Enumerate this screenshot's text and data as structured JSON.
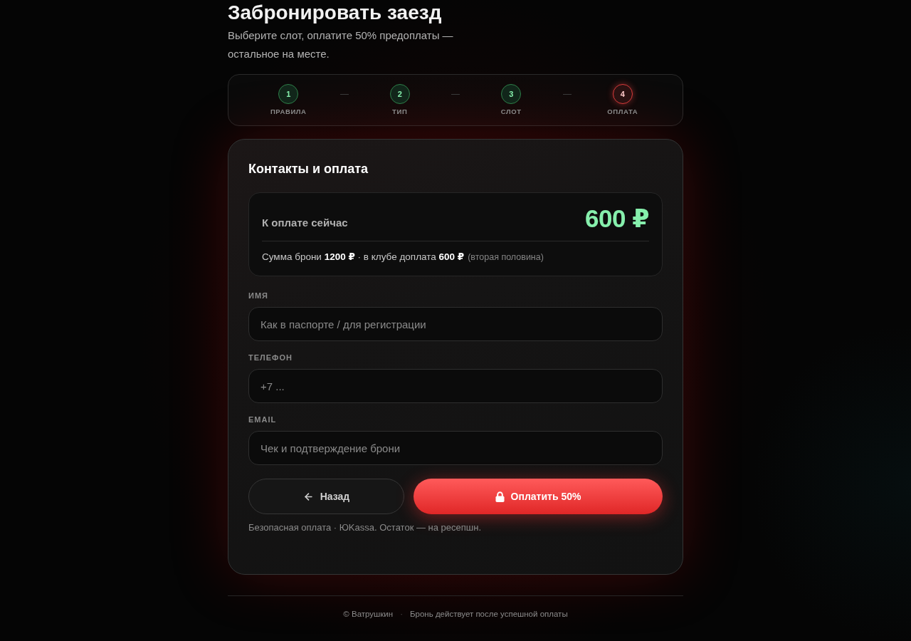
{
  "header": {
    "title": "Забронировать заезд",
    "subtitle": "Выберите слот, оплатите 50% предоплаты — остальное на месте."
  },
  "steps": [
    {
      "number": "1",
      "label": "ПРАВИЛА",
      "done": true,
      "selected": false
    },
    {
      "number": "2",
      "label": "ТИП",
      "done": true,
      "selected": false
    },
    {
      "number": "3",
      "label": "СЛОТ",
      "done": true,
      "selected": false
    },
    {
      "number": "4",
      "label": "ОПЛАТА",
      "done": false,
      "selected": true
    }
  ],
  "form": {
    "title": "Контакты и оплата",
    "summary": {
      "label": "К оплате сейчас",
      "amount": "600 ₽",
      "breakdown": "Сумма брони **1200 ₽** · в клубе доплата **600 ₽**",
      "note": "(вторая половина)"
    },
    "fields": [
      {
        "label": "ИМЯ",
        "placeholder": "Как в паспорте / для регистрации"
      },
      {
        "label": "ТЕЛЕФОН",
        "placeholder": "+7 ..."
      },
      {
        "label": "EMAIL",
        "placeholder": "Чек и подтверждение брони"
      }
    ],
    "buttons": [
      {
        "kind": "back",
        "label": "Назад"
      },
      {
        "kind": "pay",
        "label": "Оплатить 50%"
      }
    ],
    "note": "Безопасная оплата · ЮKassa. Остаток — на ресепшн."
  },
  "footer": {
    "items": [
      "© Ватрушкин",
      "·",
      "Бронь действует после успешной оплаты"
    ]
  }
}
